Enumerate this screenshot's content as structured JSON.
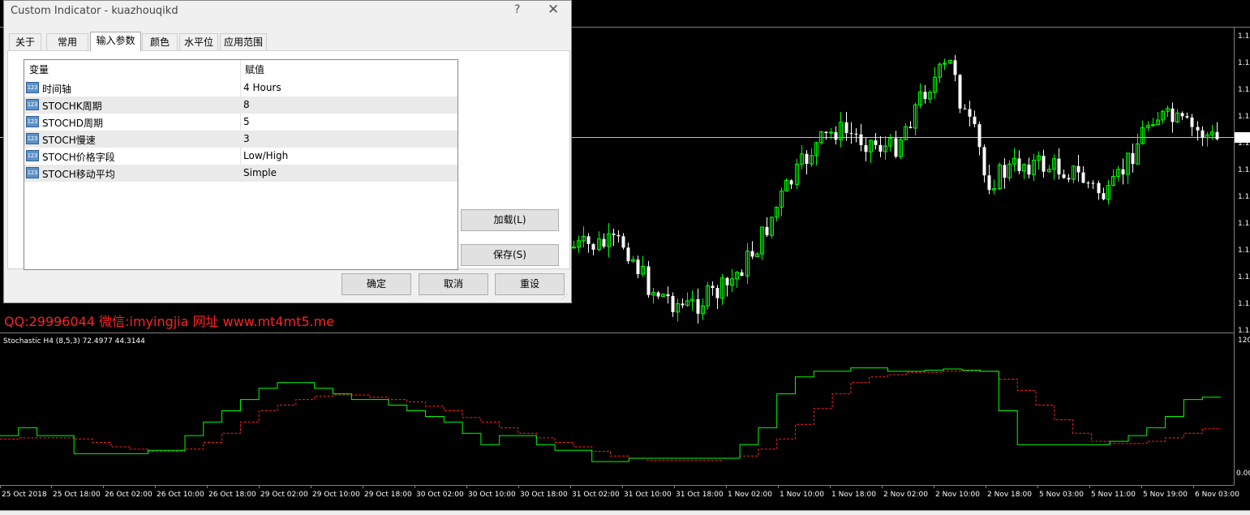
{
  "dialog": {
    "title": "Custom Indicator - kuazhouqikd",
    "help": "?",
    "close": "✕",
    "tabs": [
      "关于",
      "常用",
      "输入参数",
      "颜色",
      "水平位",
      "应用范围"
    ],
    "active_tab": "输入参数",
    "grid": {
      "headers": [
        "变量",
        "赋值"
      ],
      "rows": [
        {
          "name": "时间轴",
          "value": "4 Hours"
        },
        {
          "name": "STOCHK周期",
          "value": "8"
        },
        {
          "name": "STOCHD周期",
          "value": "5"
        },
        {
          "name": "STOCH慢速",
          "value": "3"
        },
        {
          "name": "STOCH价格字段",
          "value": "Low/High"
        },
        {
          "name": "STOCH移动平均",
          "value": "Simple"
        }
      ],
      "row_icon_text": "123"
    },
    "buttons": {
      "load": "加载(L)",
      "save": "保存(S)",
      "ok": "确定",
      "cancel": "取消",
      "reset": "重设"
    }
  },
  "watermark": "QQ:29996044 微信:imyingjia 网址 www.mt4mt5.me",
  "indicator": {
    "label": "Stochastic H4 (8,5,3)  72.4977 44.3144",
    "scale_top": "120",
    "scale_bottom": "0.00"
  },
  "price_scale_label": "1.1",
  "time_axis": [
    "25 Oct 2018",
    "25 Oct 18:00",
    "26 Oct 02:00",
    "26 Oct 10:00",
    "26 Oct 18:00",
    "29 Oct 02:00",
    "29 Oct 10:00",
    "29 Oct 18:00",
    "30 Oct 02:00",
    "30 Oct 10:00",
    "30 Oct 18:00",
    "31 Oct 02:00",
    "31 Oct 10:00",
    "31 Oct 18:00",
    "1 Nov 02:00",
    "1 Nov 10:00",
    "1 Nov 18:00",
    "2 Nov 02:00",
    "2 Nov 10:00",
    "2 Nov 18:00",
    "5 Nov 03:00",
    "5 Nov 11:00",
    "5 Nov 19:00",
    "6 Nov 03:00"
  ],
  "colors": {
    "bull": "#00ff00",
    "bear": "#ffffff",
    "main_line": "#00ff00",
    "signal_line": "#ff2020",
    "watermark": "#ff2222",
    "background": "#000000"
  },
  "chart_data": {
    "type": "line",
    "series": [
      {
        "values": [
          38,
          45,
          38,
          38,
          22,
          22,
          22,
          22,
          25,
          25,
          38,
          50,
          60,
          70,
          80,
          85,
          85,
          80,
          75,
          70,
          70,
          65,
          60,
          55,
          50,
          40,
          30,
          38,
          38,
          30,
          25,
          25,
          15,
          15,
          18,
          18,
          18,
          18,
          18,
          18,
          30,
          45,
          75,
          90,
          95,
          95,
          98,
          98,
          95,
          95,
          96,
          97,
          96,
          95,
          60,
          30,
          30,
          30,
          30,
          30,
          33,
          38,
          45,
          55,
          70,
          72
        ]
      },
      {
        "values": [
          35,
          36,
          36,
          36,
          35,
          32,
          28,
          26,
          24,
          24,
          26,
          32,
          40,
          50,
          60,
          65,
          70,
          73,
          74,
          74,
          72,
          70,
          68,
          64,
          60,
          54,
          50,
          45,
          40,
          36,
          32,
          28,
          24,
          20,
          18,
          16,
          16,
          16,
          16,
          18,
          20,
          26,
          35,
          48,
          62,
          75,
          85,
          90,
          92,
          94,
          94,
          95,
          95,
          95,
          88,
          78,
          65,
          52,
          40,
          33,
          31,
          31,
          33,
          36,
          40,
          44
        ]
      }
    ],
    "ylim": [
      0,
      120
    ]
  }
}
